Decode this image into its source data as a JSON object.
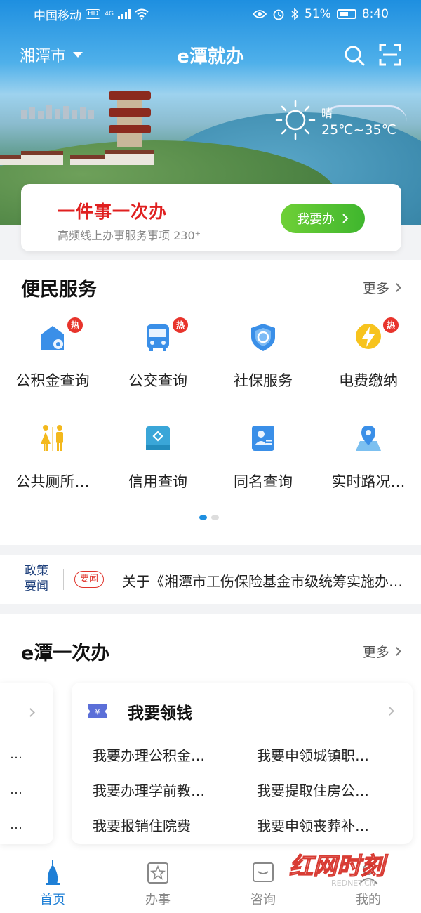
{
  "status_bar": {
    "carrier": "中国移动",
    "hd": "HD",
    "network": "4G",
    "battery": "51%",
    "time": "8:40"
  },
  "header": {
    "city": "湘潭市",
    "app_title": "e潭就办",
    "icons": [
      "search-icon",
      "scan-icon"
    ]
  },
  "weather": {
    "condition": "晴",
    "temperature": "25℃~35℃",
    "icon": "sun-icon"
  },
  "one_thing": {
    "title": "一件事一次办",
    "subtitle": "高频线上办事服务事项 230⁺",
    "button_label": "我要办"
  },
  "services": {
    "title": "便民服务",
    "more_label": "更多",
    "items": [
      {
        "label": "公积金查询",
        "hot": "热",
        "icon": "housing-fund-icon"
      },
      {
        "label": "公交查询",
        "hot": "热",
        "icon": "bus-icon"
      },
      {
        "label": "社保服务",
        "hot": "",
        "icon": "social-security-shield-icon"
      },
      {
        "label": "电费缴纳",
        "hot": "热",
        "icon": "lightning-icon"
      },
      {
        "label": "公共厕所…",
        "hot": "",
        "icon": "restroom-icon"
      },
      {
        "label": "信用查询",
        "hot": "",
        "icon": "credit-icon"
      },
      {
        "label": "同名查询",
        "hot": "",
        "icon": "person-card-icon"
      },
      {
        "label": "实时路况…",
        "hot": "",
        "icon": "map-pin-icon"
      }
    ],
    "page_count": 2,
    "current_page": 1
  },
  "news": {
    "tag": "政策要闻",
    "tag_line1": "政策",
    "tag_line2": "要闻",
    "badge": "要闻",
    "headline": "关于《湘潭市工伤保险基金市级统筹实施办法》的政策解读"
  },
  "e_once": {
    "title": "e潭一次办",
    "more_label": "更多",
    "left_card_rows": [
      "…",
      "…",
      "…"
    ],
    "card": {
      "title": "我要领钱",
      "icon": "money-ticket-icon",
      "items": [
        "我要办理公积金…",
        "我要申领城镇职…",
        "我要办理学前教…",
        "我要提取住房公…",
        "我要报销住院费",
        "我要申领丧葬补…"
      ]
    }
  },
  "tabbar": {
    "tabs": [
      {
        "label": "首页",
        "icon": "home-tower-icon",
        "active": true
      },
      {
        "label": "办事",
        "icon": "star-doc-icon",
        "active": false
      },
      {
        "label": "咨询",
        "icon": "chat-icon",
        "active": false
      },
      {
        "label": "我的",
        "icon": "user-icon",
        "active": false
      }
    ]
  },
  "watermark": {
    "text": "红网时刻",
    "sub": "REDNET.CN"
  },
  "colors": {
    "primary": "#1e8fe0",
    "accent_red": "#e02020",
    "go_green": "#3fb62e",
    "hot_red": "#e8342c"
  }
}
